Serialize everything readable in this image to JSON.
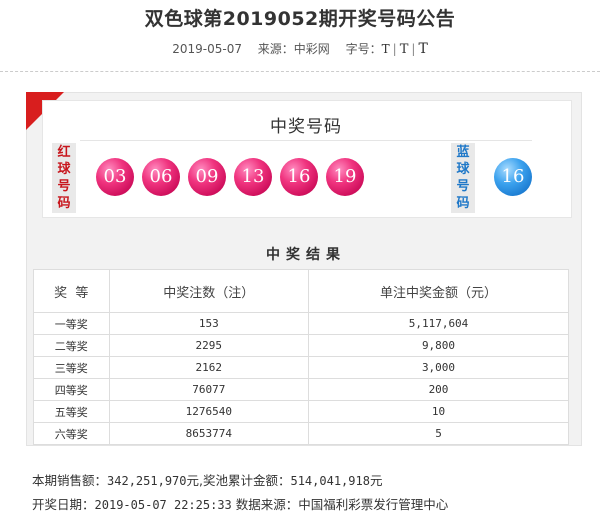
{
  "header": {
    "title": "双色球第2019052期开奖号码公告",
    "date": "2019-05-07",
    "source_label": "来源：中彩网",
    "font_label": "字号：",
    "font_small": "T",
    "font_mid": "T",
    "font_big": "T",
    "sep": "|"
  },
  "balls": {
    "title": "中奖号码",
    "red_label": [
      "红",
      "球",
      "号",
      "码"
    ],
    "blue_label": [
      "蓝",
      "球",
      "号",
      "码"
    ],
    "red": [
      "03",
      "06",
      "09",
      "13",
      "16",
      "19"
    ],
    "blue": "16"
  },
  "results": {
    "title": "中奖结果",
    "columns": [
      "奖  等",
      "中奖注数（注）",
      "单注中奖金额（元）"
    ],
    "rows": [
      [
        "一等奖",
        "153",
        "5,117,604"
      ],
      [
        "二等奖",
        "2295",
        "9,800"
      ],
      [
        "三等奖",
        "2162",
        "3,000"
      ],
      [
        "四等奖",
        "76077",
        "200"
      ],
      [
        "五等奖",
        "1276540",
        "10"
      ],
      [
        "六等奖",
        "8653774",
        "5"
      ]
    ]
  },
  "footer": {
    "sales_label": "本期销售额：",
    "sales_value": "342,251,970",
    "sales_unit": "元,奖池累计金额：",
    "pool_value": "514,041,918",
    "pool_unit": "元",
    "draw_label": "开奖日期：",
    "draw_value": "2019-05-07 22:25:33",
    "source_label": "数据来源：中国福利彩票发行管理中心"
  },
  "colors": {
    "accent_red": "#d81e1e",
    "red_ball": "#e8286f",
    "blue_ball": "#2f8fe0"
  }
}
